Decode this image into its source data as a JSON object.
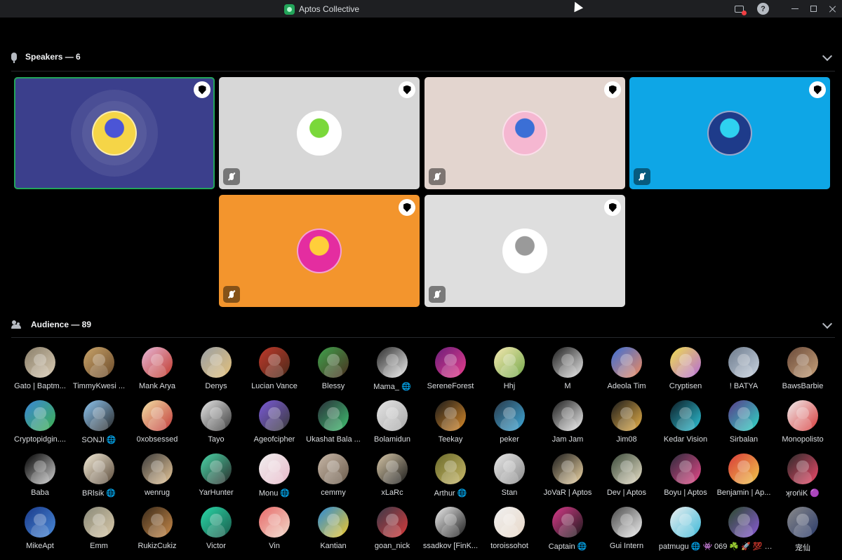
{
  "window": {
    "title": "Aptos Collective",
    "controls": [
      "minimize-icon",
      "maximize-icon",
      "close-icon"
    ],
    "help_glyph": "?"
  },
  "speakers": {
    "heading": "Speakers — 6",
    "tiles": [
      {
        "bg": "#3b3f8c",
        "avatar_colors": [
          "#f5d547",
          "#4b55d6"
        ],
        "speaking": true,
        "muted": false,
        "moderator": true
      },
      {
        "bg": "#d7d7d7",
        "avatar_colors": [
          "#ffffff",
          "#7ad83a"
        ],
        "speaking": false,
        "muted": true,
        "moderator": true
      },
      {
        "bg": "#e3d5cf",
        "avatar_colors": [
          "#f5b7d1",
          "#3b6fd6"
        ],
        "speaking": false,
        "muted": true,
        "moderator": true
      },
      {
        "bg": "#0ea6e6",
        "avatar_colors": [
          "#1e3b8a",
          "#2ed2f0"
        ],
        "speaking": false,
        "muted": true,
        "moderator": true
      },
      {
        "bg": "#f3952d",
        "avatar_colors": [
          "#e42da0",
          "#ffcf3a"
        ],
        "speaking": false,
        "muted": true,
        "moderator": true
      },
      {
        "bg": "#dedede",
        "avatar_colors": [
          "#ffffff",
          "#9a9a9a"
        ],
        "speaking": false,
        "muted": true,
        "moderator": true
      }
    ]
  },
  "audience": {
    "heading": "Audience — 89",
    "members": [
      {
        "name": "Gato | Baptm...",
        "colors": [
          "#8a7f6a",
          "#d9cbb4"
        ]
      },
      {
        "name": "TimmyKwesi ...",
        "colors": [
          "#c9a46a",
          "#6b4a2a"
        ]
      },
      {
        "name": "Mank Arya",
        "colors": [
          "#e7b8d9",
          "#c0392b"
        ]
      },
      {
        "name": "Denys",
        "colors": [
          "#9aa0a6",
          "#e3c07a"
        ]
      },
      {
        "name": "Lucian Vance",
        "colors": [
          "#c0392b",
          "#4a2a1a"
        ]
      },
      {
        "name": "Blessy",
        "colors": [
          "#3fa34d",
          "#4a2e1f"
        ]
      },
      {
        "name": "Mama_ 🌐",
        "colors": [
          "#2b2b2b",
          "#eeeeee"
        ]
      },
      {
        "name": "SereneForest",
        "colors": [
          "#6b1e7a",
          "#e83e8c"
        ]
      },
      {
        "name": "Hhj",
        "colors": [
          "#f6e9b2",
          "#74a84a"
        ]
      },
      {
        "name": "M",
        "colors": [
          "#1c1c1c",
          "#e8e8e8"
        ]
      },
      {
        "name": "Adeola Tim",
        "colors": [
          "#3a6fd8",
          "#f08a5d"
        ]
      },
      {
        "name": "Cryptisen",
        "colors": [
          "#f0e04f",
          "#b56ad8"
        ]
      },
      {
        "name": "! BATYA",
        "colors": [
          "#6d7b8c",
          "#c8d3e0"
        ]
      },
      {
        "name": "BawsBarbie",
        "colors": [
          "#6a4a3a",
          "#c8a27a"
        ]
      },
      {
        "name": "Cryptopidgin....",
        "colors": [
          "#3a86d8",
          "#3fb04f"
        ]
      },
      {
        "name": "SONJI 🌐",
        "colors": [
          "#8ec5f0",
          "#2a2a2a"
        ]
      },
      {
        "name": "0xobsessed",
        "colors": [
          "#f2e2a6",
          "#c23a3a"
        ]
      },
      {
        "name": "Tayo",
        "colors": [
          "#e8e8e8",
          "#3a3a3a"
        ]
      },
      {
        "name": "Ageofcipher",
        "colors": [
          "#7a5ad8",
          "#3a3a3a"
        ]
      },
      {
        "name": "Ukashat Bala ...",
        "colors": [
          "#2a2f3a",
          "#3fbf6f"
        ]
      },
      {
        "name": "Bolamidun",
        "colors": [
          "#e5e5e5",
          "#a8a8a8"
        ]
      },
      {
        "name": "Teekay",
        "colors": [
          "#1a1a1a",
          "#d88a2a"
        ]
      },
      {
        "name": "peker",
        "colors": [
          "#2a3a4a",
          "#3fa8d8"
        ]
      },
      {
        "name": "Jam Jam",
        "colors": [
          "#1c1c1c",
          "#f0f0f0"
        ]
      },
      {
        "name": "Jim08",
        "colors": [
          "#1a1a1a",
          "#e8b24a"
        ]
      },
      {
        "name": "Kedar Vision",
        "colors": [
          "#0d1b24",
          "#2ec4d8"
        ]
      },
      {
        "name": "Sirbalan",
        "colors": [
          "#5a3a8a",
          "#2ed8c4"
        ]
      },
      {
        "name": "Monopolisto",
        "colors": [
          "#f0f0f0",
          "#d83a3a"
        ]
      },
      {
        "name": "Baba",
        "colors": [
          "#000000",
          "#cfcfcf"
        ]
      },
      {
        "name": "BRlsik 🌐",
        "colors": [
          "#f4ecd8",
          "#5a4a3a"
        ]
      },
      {
        "name": "wenrug",
        "colors": [
          "#3a3a3a",
          "#e8c89a"
        ]
      },
      {
        "name": "YarHunter",
        "colors": [
          "#4ad8a8",
          "#2a2a2a"
        ]
      },
      {
        "name": "Monu 🌐",
        "colors": [
          "#f0f0f0",
          "#e8b8c8"
        ]
      },
      {
        "name": "cemmy",
        "colors": [
          "#c8b8a8",
          "#6a5a4a"
        ]
      },
      {
        "name": "xLaRc",
        "colors": [
          "#d8c8a8",
          "#1a1a1a"
        ]
      },
      {
        "name": "Arthur 🌐",
        "colors": [
          "#6a6a2a",
          "#c8b86a"
        ]
      },
      {
        "name": "Stan",
        "colors": [
          "#e8e8e8",
          "#8a8a8a"
        ]
      },
      {
        "name": "JoVaR | Aptos",
        "colors": [
          "#1a1a1a",
          "#f0d8a8"
        ]
      },
      {
        "name": "Dev | Aptos",
        "colors": [
          "#3a4a3a",
          "#e8e0c8"
        ]
      },
      {
        "name": "Boyu | Aptos",
        "colors": [
          "#2a2a3a",
          "#e84a8a"
        ]
      },
      {
        "name": "Benjamin | Ap...",
        "colors": [
          "#d83a3a",
          "#f0c84a"
        ]
      },
      {
        "name": "ʞrońiK 🟣",
        "colors": [
          "#2a2a2a",
          "#f04a6a"
        ]
      },
      {
        "name": "MikeApt",
        "colors": [
          "#1a3a8a",
          "#4a8ad8"
        ]
      },
      {
        "name": "Emm",
        "colors": [
          "#8a8a7a",
          "#d8c8a8"
        ]
      },
      {
        "name": "RukizCukiz",
        "colors": [
          "#3a2a1a",
          "#c88a4a"
        ]
      },
      {
        "name": "Victor",
        "colors": [
          "#2ad8a8",
          "#1a5a4a"
        ]
      },
      {
        "name": "Vin",
        "colors": [
          "#e86a6a",
          "#f0d8c8"
        ]
      },
      {
        "name": "Kantian",
        "colors": [
          "#2a8ad8",
          "#f0c82a"
        ]
      },
      {
        "name": "goan_nick",
        "colors": [
          "#3a3a4a",
          "#d83a3a"
        ]
      },
      {
        "name": "ssadkov [FinK...",
        "colors": [
          "#f0f0f0",
          "#1a1a1a"
        ]
      },
      {
        "name": "toroissohot",
        "colors": [
          "#f0f0f0",
          "#e8d8c8"
        ]
      },
      {
        "name": "Captain 🌐",
        "colors": [
          "#d83a8a",
          "#1a1a1a"
        ]
      },
      {
        "name": "Gui Intern",
        "colors": [
          "#4a4a4a",
          "#f0f0f0"
        ]
      },
      {
        "name": "patmugu 🌐 👾",
        "colors": [
          "#f0f0f0",
          "#3ab8d8"
        ]
      },
      {
        "name": "069 ☘️ 🚀 💯 C...",
        "colors": [
          "#2a4a2a",
          "#8a5ad8"
        ]
      },
      {
        "name": "宠仙",
        "colors": [
          "#8a8a8a",
          "#2a3a6a"
        ]
      }
    ]
  }
}
